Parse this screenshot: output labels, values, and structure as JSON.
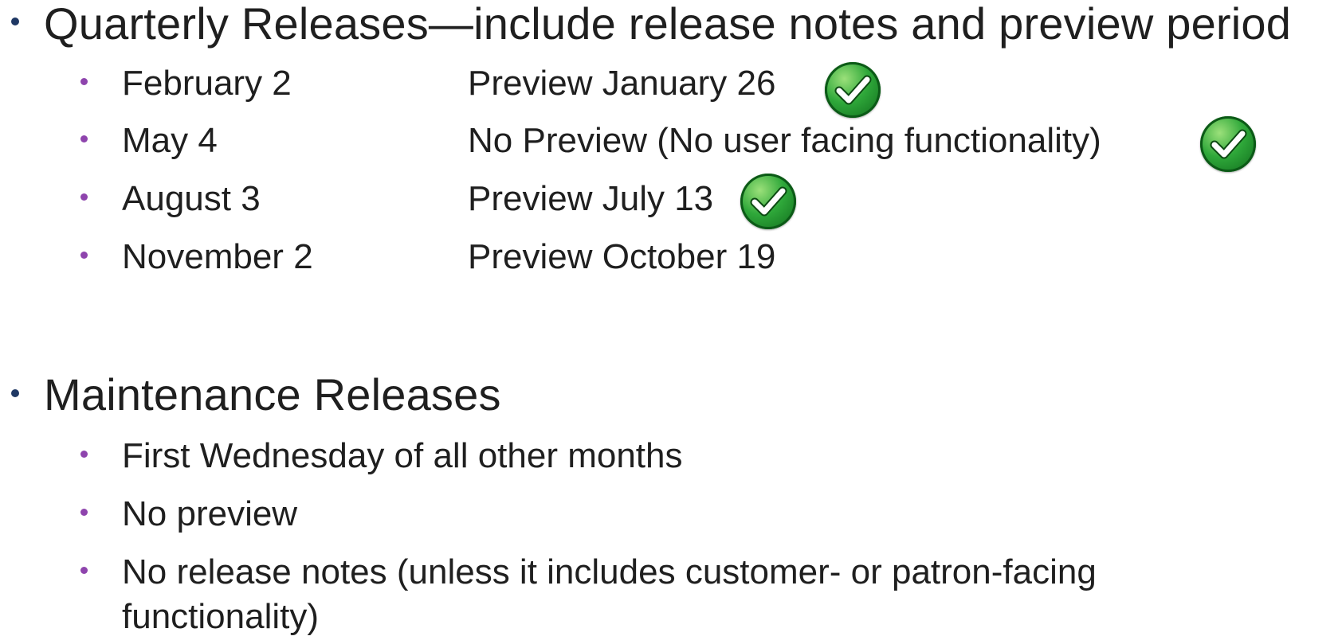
{
  "quarterly": {
    "heading": "Quarterly Releases—include release notes and preview period",
    "rows": [
      {
        "date": "February 2",
        "preview": "Preview January 26"
      },
      {
        "date": "May 4",
        "preview": "No Preview (No user facing functionality)"
      },
      {
        "date": "August 3",
        "preview": "Preview July 13"
      },
      {
        "date": "November 2",
        "preview": "Preview October 19"
      }
    ]
  },
  "maintenance": {
    "heading": "Maintenance Releases",
    "items": [
      "First Wednesday of all other months",
      "No preview",
      "No release notes (unless it includes customer- or patron-facing",
      "functionality)"
    ]
  },
  "icons": {
    "check": "checkmark-icon"
  },
  "colors": {
    "level1_bullet": "#1f3864",
    "level2_bullet": "#8e44ad",
    "check_green": "#2fa83a"
  }
}
